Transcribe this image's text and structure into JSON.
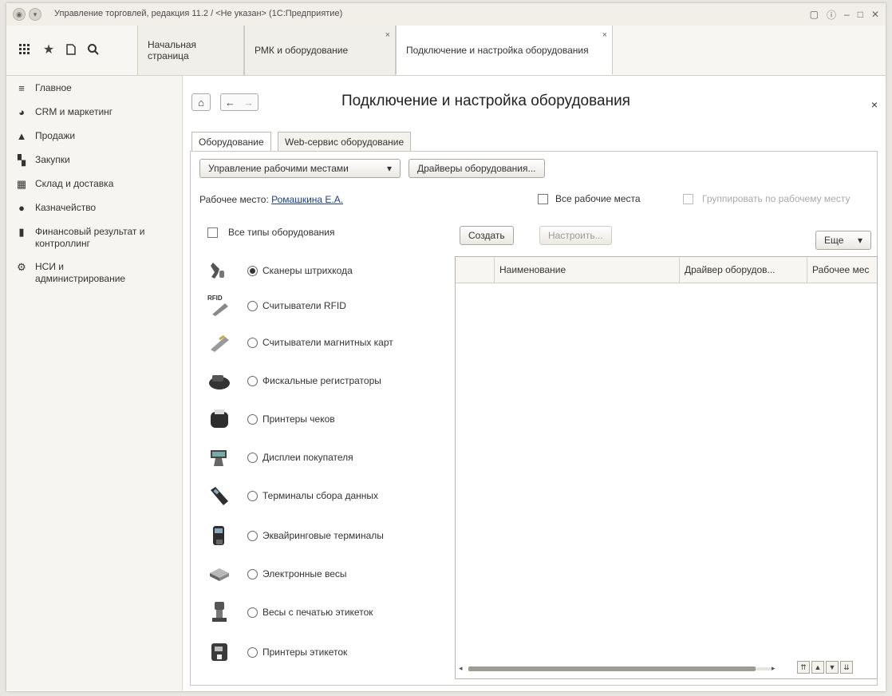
{
  "window": {
    "title": "Управление торговлей, редакция 11.2 / <Не указан> (1С:Предприятие)"
  },
  "tabs": [
    {
      "label": "Начальная страница"
    },
    {
      "label": "РМК и оборудование"
    },
    {
      "label": "Подключение и настройка оборудования"
    }
  ],
  "sidebar": {
    "items": [
      {
        "label": "Главное",
        "icon": "menu-icon"
      },
      {
        "label": "CRM и маркетинг",
        "icon": "crm-icon"
      },
      {
        "label": "Продажи",
        "icon": "sales-icon"
      },
      {
        "label": "Закупки",
        "icon": "cart-icon"
      },
      {
        "label": "Склад и доставка",
        "icon": "warehouse-icon"
      },
      {
        "label": "Казначейство",
        "icon": "treasury-icon"
      },
      {
        "label": "Финансовый результат и контроллинг",
        "icon": "chart-icon"
      },
      {
        "label": "НСИ и администрирование",
        "icon": "gear-icon"
      }
    ]
  },
  "page": {
    "title": "Подключение и настройка оборудования",
    "subtabs": [
      "Оборудование",
      "Web-сервис оборудование"
    ],
    "buttons": {
      "manage_workplaces": "Управление рабочими местами",
      "drivers": "Драйверы оборудования...",
      "create": "Создать",
      "configure": "Настроить...",
      "more": "Еще"
    },
    "workplace_label": "Рабочее место:",
    "workplace_value": "Ромашкина Е.А.",
    "all_workplaces": "Все рабочие места",
    "group_by_workplace": "Группировать по рабочему месту",
    "all_types": "Все типы оборудования",
    "equipment_types": [
      {
        "label": "Сканеры штрихкода",
        "selected": true
      },
      {
        "label": "Считыватели RFID",
        "selected": false
      },
      {
        "label": "Считыватели магнитных карт",
        "selected": false
      },
      {
        "label": "Фискальные регистраторы",
        "selected": false
      },
      {
        "label": "Принтеры чеков",
        "selected": false
      },
      {
        "label": "Дисплеи покупателя",
        "selected": false
      },
      {
        "label": "Терминалы сбора данных",
        "selected": false
      },
      {
        "label": "Эквайринговые терминалы",
        "selected": false
      },
      {
        "label": "Электронные весы",
        "selected": false
      },
      {
        "label": "Весы с печатью этикеток",
        "selected": false
      },
      {
        "label": "Принтеры этикеток",
        "selected": false
      }
    ],
    "rfid_tag": "RFID",
    "table": {
      "columns": [
        "Наименование",
        "Драйвер оборудов...",
        "Рабочее мес"
      ]
    }
  }
}
